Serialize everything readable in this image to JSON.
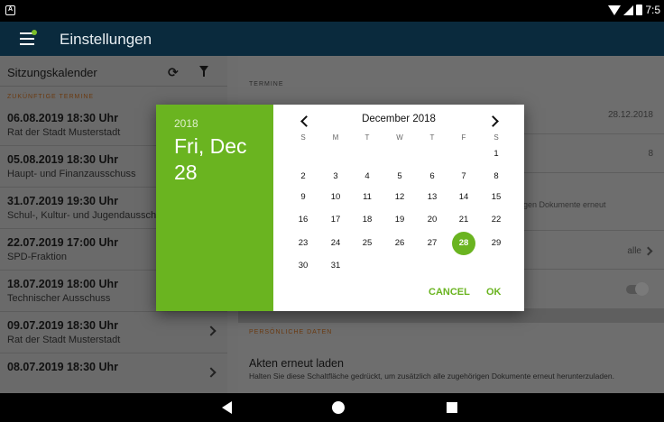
{
  "statusbar": {
    "notification_glyph": "A",
    "time": "7:5"
  },
  "appbar": {
    "title": "Einstellungen"
  },
  "sidebar": {
    "header": "Sitzungskalender",
    "section": "ZUKÜNFTIGE TERMINE",
    "items": [
      {
        "date": "06.08.2019 18:30 Uhr",
        "org": "Rat der Stadt Musterstadt"
      },
      {
        "date": "05.08.2019 18:30 Uhr",
        "org": "Haupt- und Finanzausschuss"
      },
      {
        "date": "31.07.2019 19:30 Uhr",
        "org": "Schul-, Kultur- und Jugendausschuss"
      },
      {
        "date": "22.07.2019 17:00 Uhr",
        "org": "SPD-Fraktion"
      },
      {
        "date": "18.07.2019 18:00 Uhr",
        "org": "Technischer Ausschuss"
      },
      {
        "date": "09.07.2019 18:30 Uhr",
        "org": "Rat der Stadt Musterstadt"
      },
      {
        "date": "08.07.2019 18:30 Uhr",
        "org": ""
      }
    ]
  },
  "settings": {
    "termine_section": "TERMINE",
    "termine_date_value": "28.12.2018",
    "termine_number_value": "8",
    "erneut_text": "gen Dokumente erneut",
    "alle_label": "alle",
    "personal_section": "PERSÖNLICHE DATEN",
    "akten_title": "Akten erneut laden",
    "akten_desc": "Halten Sie diese Schaltfläche gedrückt, um zusätzlich alle zugehörigen Dokumente erneut herunterzuladen."
  },
  "datepicker": {
    "year": "2018",
    "selected_date": "Fri, Dec 28",
    "month_label": "December 2018",
    "weekdays": [
      "S",
      "M",
      "T",
      "W",
      "T",
      "F",
      "S"
    ],
    "first_weekday_index": 6,
    "days_in_month": 31,
    "selected_day": 28,
    "cancel_label": "CANCEL",
    "ok_label": "OK",
    "accent_color": "#6ab420"
  },
  "navbar": {
    "icons": [
      "back-icon",
      "home-icon",
      "recents-icon"
    ]
  }
}
